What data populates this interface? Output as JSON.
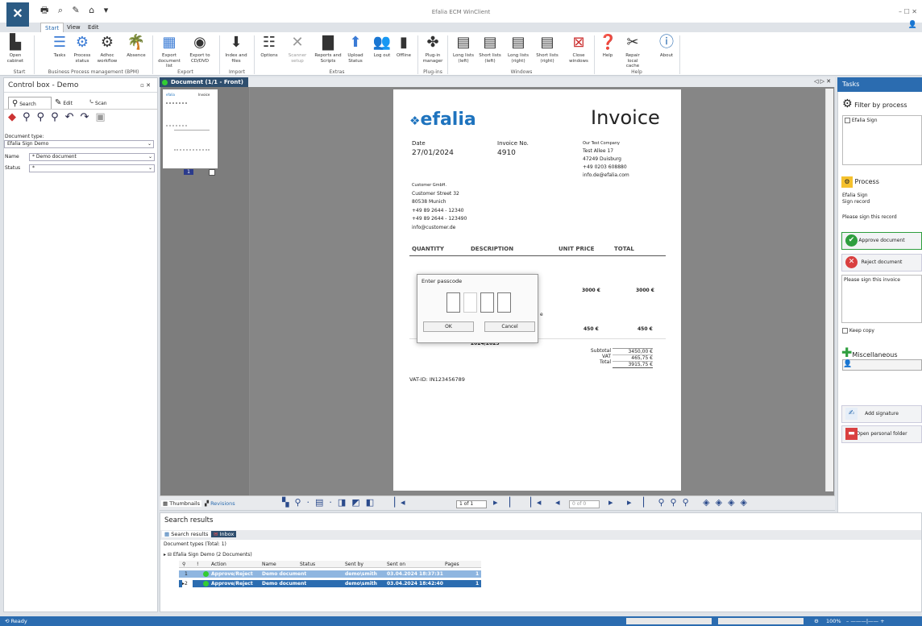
{
  "window": {
    "title": "Efalia ECM WinClient",
    "logo": "✕"
  },
  "tabs": [
    "Start",
    "View",
    "Edit"
  ],
  "ribbon": {
    "buttons": [
      {
        "label": "Open cabinet",
        "icon": "cabinet-icon"
      },
      {
        "label": "Tasks",
        "icon": "tasks-icon"
      },
      {
        "label": "Process status",
        "icon": "process-status-icon"
      },
      {
        "label": "Adhoc workflow",
        "icon": "adhoc-workflow-icon"
      },
      {
        "label": "Absence",
        "icon": "palm-icon"
      },
      {
        "label": "Export document list",
        "icon": "export-list-icon"
      },
      {
        "label": "Export to CD/DVD",
        "icon": "cd-icon"
      },
      {
        "label": "Index and files",
        "icon": "index-icon"
      },
      {
        "label": "Options",
        "icon": "options-icon"
      },
      {
        "label": "Scanner setup",
        "icon": "scanner-icon"
      },
      {
        "label": "Reports and Scripts",
        "icon": "reports-icon"
      },
      {
        "label": "Upload Status",
        "icon": "upload-icon"
      },
      {
        "label": "Log out",
        "icon": "logout-icon"
      },
      {
        "label": "Offline",
        "icon": "offline-icon"
      },
      {
        "label": "Plug-in manager",
        "icon": "plugin-icon"
      },
      {
        "label": "Long lists (left)",
        "icon": "longlist-left-icon"
      },
      {
        "label": "Short lists (left)",
        "icon": "shortlist-left-icon"
      },
      {
        "label": "Long lists (right)",
        "icon": "longlist-right-icon"
      },
      {
        "label": "Short lists (right)",
        "icon": "shortlist-right-icon"
      },
      {
        "label": "Close windows",
        "icon": "close-windows-icon"
      },
      {
        "label": "Help",
        "icon": "help-icon"
      },
      {
        "label": "Repair local cache",
        "icon": "repair-icon"
      },
      {
        "label": "About",
        "icon": "about-icon"
      }
    ],
    "groups": [
      "Start",
      "Business Process management (BPM)",
      "Export",
      "Import",
      "Extras",
      "Plug-ins",
      "Windows",
      "Help"
    ]
  },
  "control_box": {
    "title": "Control box - Demo",
    "tabs": [
      "Search",
      "Edit",
      "Scan"
    ],
    "doc_type_label": "Document type:",
    "doc_type_value": "Efalia Sign Demo",
    "name_label": "Name",
    "name_value": "* Demo document",
    "status_label": "Status",
    "status_value": "*"
  },
  "document": {
    "tab_label": "Document (1/1 - Front)",
    "thumb_page": "1",
    "thumbnails_label": "Thumbnails",
    "revisions_label": "Revisions",
    "page_counter": "1 of 1",
    "page_counter2": "0 of 0"
  },
  "invoice": {
    "brand": "efalia",
    "title": "Invoice",
    "date_label": "Date",
    "date_value": "27/01/2024",
    "invno_label": "Invoice No.",
    "invno_value": "4910",
    "company": [
      "Our Test Company",
      "Test Allee 17",
      "47249 Duisburg",
      "+49 0203 608880",
      "info.de@efalia.com"
    ],
    "customer": [
      "Customer GmbH.",
      "Customer Street 32",
      "80538 Munich",
      "+49 89 2644 - 12340",
      "+49 89 2644 - 123490",
      "info@customer.de"
    ],
    "cols": [
      "QUANTITY",
      "DESCRIPTION",
      "UNIT PRICE",
      "TOTAL"
    ],
    "line1_unit": "3000 €",
    "line1_total": "3000 €",
    "line2_unit": "450 €",
    "line2_total": "450 €",
    "period": "2024/2025",
    "subtotal_label": "Subtotal",
    "subtotal_value": "3450,00 €",
    "vat_label": "VAT",
    "vat_value": "465,75 €",
    "total_label": "Total",
    "total_value": "3915,75 €",
    "vat_id": "VAT-ID: IN123456789"
  },
  "dialog": {
    "title": "Enter passcode",
    "ok": "OK",
    "cancel": "Cancel"
  },
  "tasks": {
    "title": "Tasks",
    "filter_label": "Filter by process",
    "filter_item": "Efalia Sign",
    "process_label": "Process",
    "process_name": "Efalia Sign",
    "process_record": "Sign record",
    "instruction": "Please sign this record",
    "approve": "Approve document",
    "reject": "Reject document",
    "comment": "Please sign this invoice",
    "keep_copy": "Keep copy",
    "misc_label": "Miscellaneous",
    "add_signature": "Add signature",
    "open_folder": "Open personal folder"
  },
  "results": {
    "title": "Search results",
    "tabs": [
      "Search results",
      "Inbox"
    ],
    "doc_types": "Document types (Total: 1)",
    "group": "Efalia Sign Demo (2 Documents)",
    "columns": [
      "!",
      "Action",
      "Name",
      "Status",
      "Sent by",
      "Sent on",
      "Pages"
    ],
    "rows": [
      {
        "num": "1",
        "action": "Approve/Reject",
        "name": "Demo document",
        "status": "",
        "sent_by": "demo\\smith",
        "sent_on": "03.04.2024 18:37:31",
        "pages": "1"
      },
      {
        "num": "2",
        "action": "Approve/Reject",
        "name": "Demo document",
        "status": "",
        "sent_by": "demo\\smith",
        "sent_on": "03.04.2024 18:42:40",
        "pages": "1"
      }
    ]
  },
  "status": {
    "text": "Ready",
    "zoom": "100%"
  },
  "colors": {
    "accent": "#2b6cb0",
    "approve": "#2e9e3e",
    "reject": "#d94040",
    "brand": "#1e73be"
  }
}
